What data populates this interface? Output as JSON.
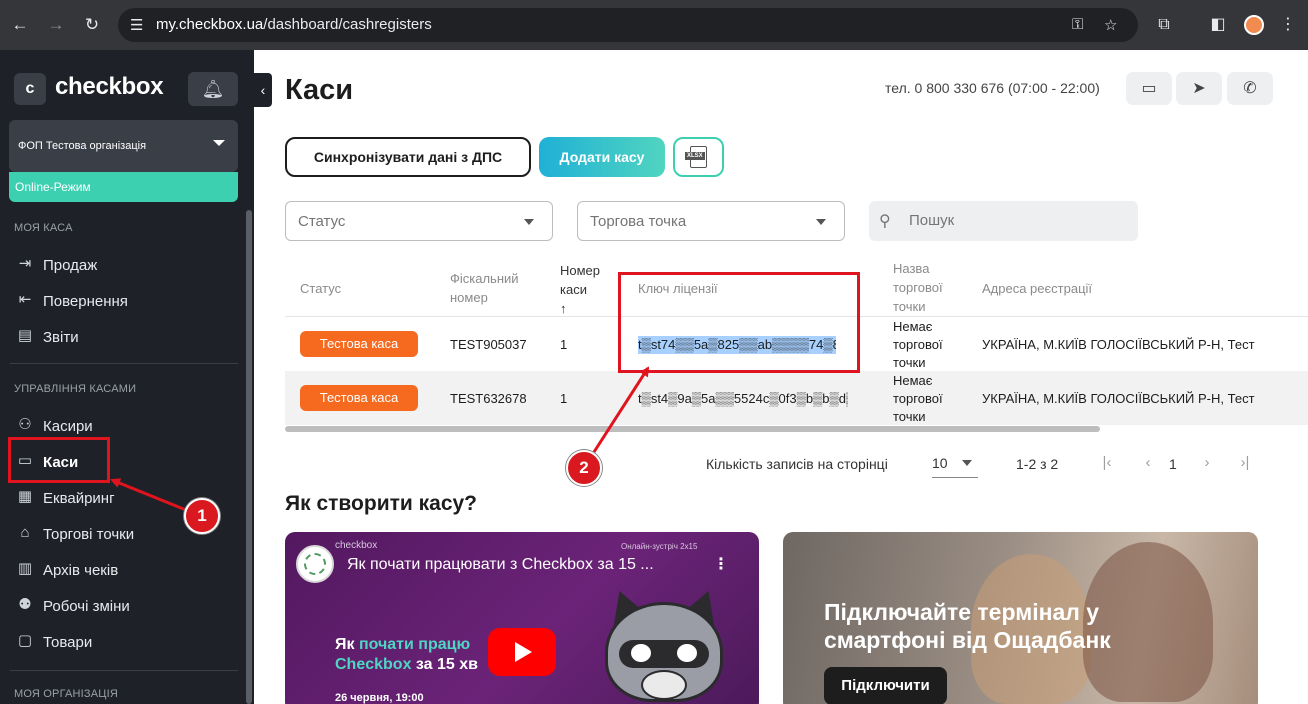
{
  "browser": {
    "url_host": "my.checkbox.ua",
    "url_path": "/dashboard/cashregisters"
  },
  "sidebar": {
    "logo_mark": "c",
    "logo_text": "checkbox",
    "org_name": "ФОП Тестова організація",
    "online_mode": "Online-Режим",
    "section_my_cash": "МОЯ КАСА",
    "section_management": "УПРАВЛІННЯ КАСАМИ",
    "section_my_org": "МОЯ ОРГАНІЗАЦІЯ",
    "my_cash_items": [
      {
        "label": "Продаж",
        "icon": "sale-icon"
      },
      {
        "label": "Повернення",
        "icon": "return-icon"
      },
      {
        "label": "Звіти",
        "icon": "reports-icon"
      }
    ],
    "management_items": [
      {
        "label": "Касири",
        "icon": "cashiers-icon"
      },
      {
        "label": "Каси",
        "icon": "cash-register-icon"
      },
      {
        "label": "Еквайринг",
        "icon": "acquiring-icon"
      },
      {
        "label": "Торгові точки",
        "icon": "shops-icon"
      },
      {
        "label": "Архів чеків",
        "icon": "archive-icon"
      },
      {
        "label": "Робочі зміни",
        "icon": "shifts-icon"
      },
      {
        "label": "Товари",
        "icon": "goods-icon"
      }
    ],
    "active_item": "Каси"
  },
  "header": {
    "title": "Каси",
    "phone": "тел. 0 800 330 676 (07:00 - 22:00)"
  },
  "toolbar": {
    "sync_label": "Синхронізувати дані з ДПС",
    "add_label": "Додати касу",
    "xlsx_label": "XLSX"
  },
  "filters": {
    "status_placeholder": "Статус",
    "shop_placeholder": "Торгова точка",
    "search_placeholder": "Пошук"
  },
  "table": {
    "columns": {
      "status": "Статус",
      "fiscal_1": "Фіскальний",
      "fiscal_2": "номер",
      "num_1": "Номер",
      "num_2": "каси",
      "sort_arrow": "↑",
      "license": "Ключ ліцензії",
      "shop_1": "Назва",
      "shop_2": "торгової",
      "shop_3": "точки",
      "address": "Адреса реєстрації"
    },
    "rows": [
      {
        "status": "Тестова каса",
        "fiscal": "TEST905037",
        "number": "1",
        "license": "t▒st74▒▒5a▒825▒▒ab▒▒▒▒74▒8▒▒",
        "shop_1": "Немає",
        "shop_2": "торгової",
        "shop_3": "точки",
        "address": "УКРАЇНА, М.КИЇВ ГОЛОСІЇВСЬКИЙ Р-Н, Тест"
      },
      {
        "status": "Тестова каса",
        "fiscal": "TEST632678",
        "number": "1",
        "license": "t▒st4▒9a▒5a▒▒5524c▒0f3▒b▒b▒d▒",
        "shop_1": "Немає",
        "shop_2": "торгової",
        "shop_3": "точки",
        "address": "УКРАЇНА, М.КИЇВ ГОЛОСІЇВСЬКИЙ Р-Н, Тест"
      }
    ]
  },
  "pagination": {
    "per_page_label": "Кількість записів на сторінці",
    "per_page_value": "10",
    "range": "1-2 з 2",
    "first": "|‹",
    "prev": "‹",
    "page": "1",
    "next": "›",
    "last": "›|"
  },
  "how_to": {
    "title": "Як створити касу?"
  },
  "video": {
    "brand": "checkbox",
    "top_right": "Онлайн-зустріч 2х15",
    "title": "Як почати працювати з Checkbox за 15 ...",
    "line1_plain": "Як ",
    "line1_hl": "почати працю",
    "line2_hl": "Checkbox",
    "line2_plain": " за 15 хв",
    "date": "26 червня, 19:00"
  },
  "promo": {
    "line1": "Підключайте термінал у",
    "line2": "смартфоні від Ощадбанк",
    "button": "Підключити"
  },
  "annotations": {
    "marker1": "1",
    "marker2": "2",
    "color": "#e0141e"
  }
}
